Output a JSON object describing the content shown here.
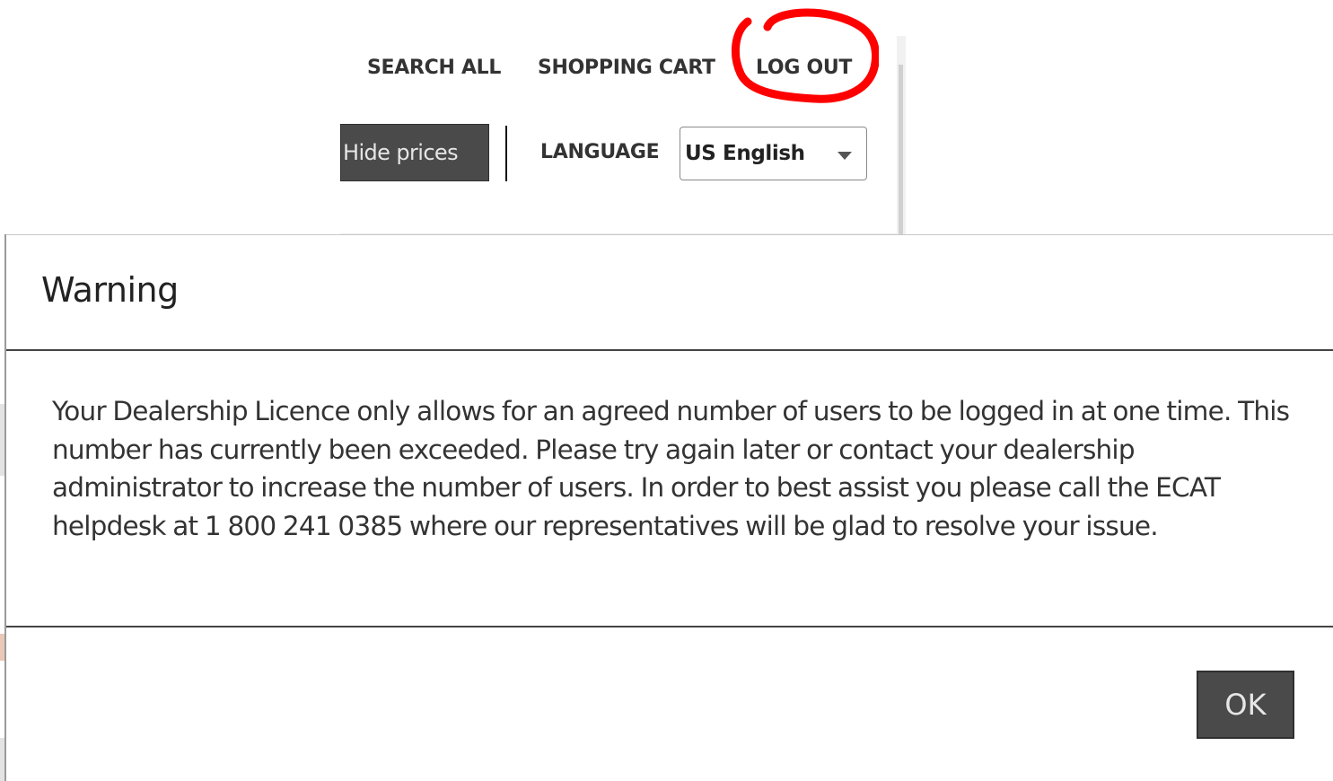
{
  "header": {
    "nav": {
      "search_all": "SEARCH ALL",
      "shopping_cart": "SHOPPING CART",
      "log_out": "LOG OUT"
    },
    "hide_prices_label": "Hide prices",
    "language_label": "LANGUAGE",
    "language_select": {
      "selected": "US English"
    },
    "annotation": {
      "shape": "hand-drawn circle around LOG OUT",
      "color": "#ff0000"
    }
  },
  "dialog": {
    "title": "Warning",
    "message": "Your Dealership Licence only allows for an agreed number of users to be logged in at one time. This number has currently been exceeded. Please try again later or contact your dealership administrator to increase the number of users. In order to best assist you please call the ECAT helpdesk at 1 800 241 0385 where our representatives will be glad to resolve your issue.",
    "ok_label": "OK"
  },
  "icons": {
    "language_dropdown": "chevron-down-icon"
  },
  "colors": {
    "button_bg": "#4a4a4a",
    "button_text": "#e6e6e6",
    "annotation_red": "#ff0000",
    "separator": "#444444"
  }
}
